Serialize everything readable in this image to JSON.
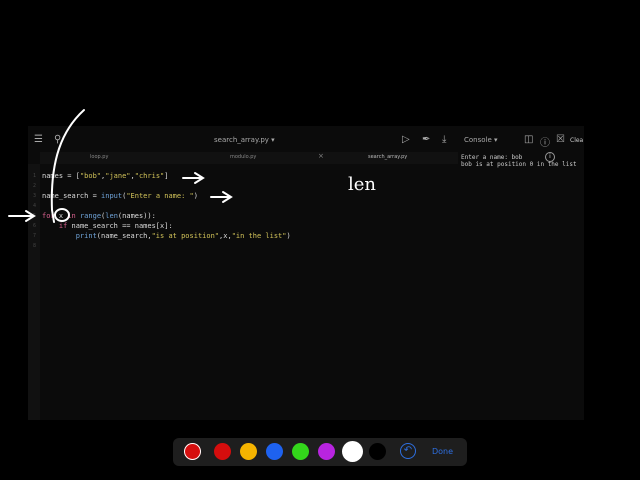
{
  "toolbar": {
    "file_title": "search_array.py ▾",
    "console_title": "Console ▾",
    "clear_label": "Clea"
  },
  "tabs": [
    {
      "label": "loop.py"
    },
    {
      "label": "modulo.py"
    },
    {
      "label": "search_array.py",
      "active": true
    }
  ],
  "tab_close": "×",
  "code_lines": [
    {
      "num": "1",
      "text": "names = [\"bob\",\"jane\",\"chris\"]"
    },
    {
      "num": "2",
      "text": ""
    },
    {
      "num": "3",
      "text": "name_search = input(\"Enter a name: \")"
    },
    {
      "num": "4",
      "text": ""
    },
    {
      "num": "5",
      "text": "for x in range(len(names)):"
    },
    {
      "num": "6",
      "text": "    if name_search == names[x]:"
    },
    {
      "num": "7",
      "text": "        print(name_search,\"is at position\",x,\"in the list\")"
    },
    {
      "num": "8",
      "text": ""
    }
  ],
  "console_output": [
    "Enter a name: bob",
    "bob is at position 0 in the list"
  ],
  "annotation_text": "len",
  "palette": {
    "colors": [
      "#d60f0f",
      "#d50d0d",
      "#f5b400",
      "#1e62f0",
      "#33d61b",
      "#b824e0",
      "#ffffff",
      "#000000"
    ],
    "selected_index": 6,
    "done_label": "Done"
  },
  "colors": {
    "keyword": "#d8618f",
    "string": "#d4c55a",
    "builtin": "#6fa3d8",
    "plain": "#dcdcdc",
    "accent": "#2e6fe0"
  }
}
